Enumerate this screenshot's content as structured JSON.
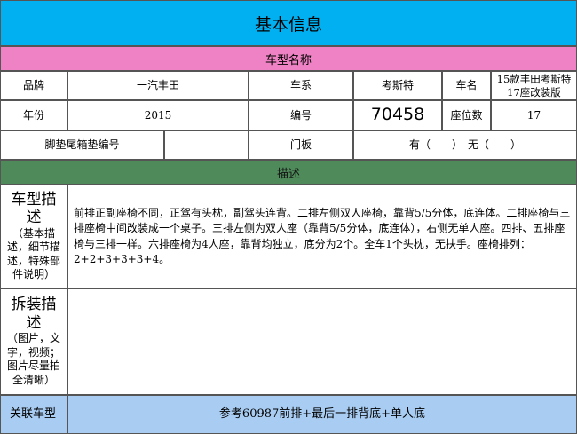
{
  "header": {
    "title": "基本信息"
  },
  "model_section": {
    "title": "车型名称"
  },
  "fields": {
    "brand_label": "品牌",
    "brand_value": "一汽丰田",
    "series_label": "车系",
    "series_value": "考斯特",
    "name_label": "车名",
    "name_value": "15款丰田考斯特17座改装版",
    "year_label": "年份",
    "year_value": "2015",
    "number_label": "编号",
    "number_value": "70458",
    "seats_label": "座位数",
    "seats_value": "17",
    "mat_label": "脚垫尾箱垫编号",
    "mat_value": "",
    "door_label": "门板",
    "door_value": "有（　　）　无（　　）"
  },
  "desc_section": {
    "title": "描述"
  },
  "model_desc": {
    "heading": "车型描述",
    "sub": "（基本描述，细节描述，特殊部件说明）",
    "text": "前排正副座椅不同，正驾有头枕，副驾头连背。二排左侧双人座椅，靠背5/5分体，底连体。二排座椅与三排座椅中间改装成一个桌子。三排左侧为双人座（靠背5/5分体，底连体），右侧无单人座。四排、五排座椅与三排一样。六排座椅为4人座，靠背均独立，底分为2个。全车1个头枕，无扶手。座椅排列：2+2+3+3+3+4。"
  },
  "disassembly": {
    "heading": "拆装描述",
    "sub": "（图片，文字，视频；图片尽量拍全清晰）",
    "text": ""
  },
  "related": {
    "label": "关联车型",
    "value": "参考60987前排+最后一排背底+单人底"
  },
  "colors": {
    "title_band": "#00b0f0",
    "model_band": "#ee82c4",
    "desc_band": "#4f8a5a",
    "related_band": "#a9cdf2"
  }
}
